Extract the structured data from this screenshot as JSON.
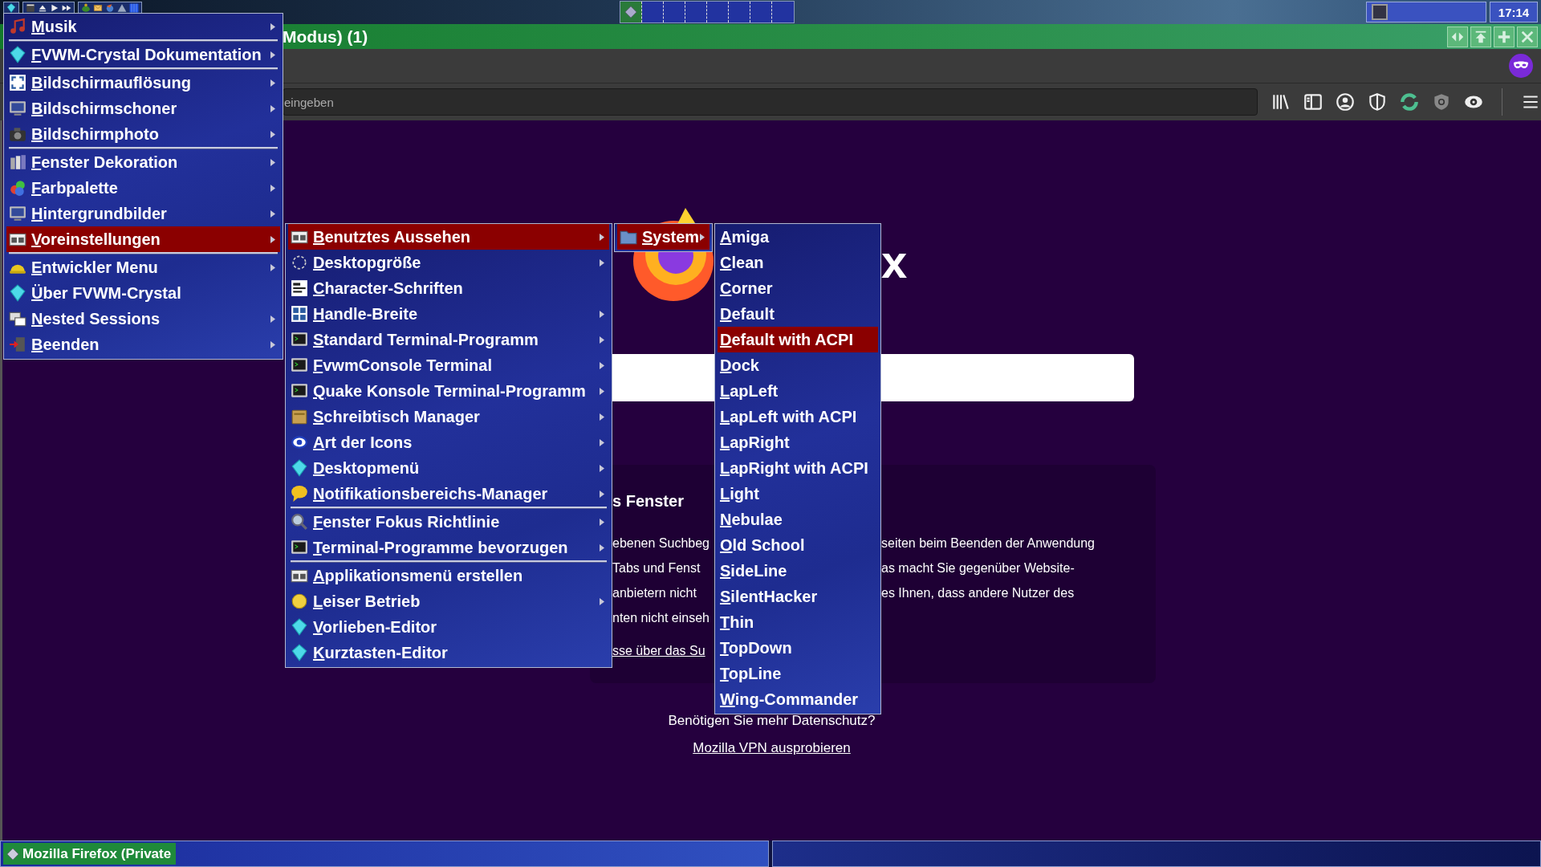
{
  "top_panel": {
    "clock": "17:14"
  },
  "window": {
    "title": "Modus) (1)"
  },
  "url_bar": {
    "placeholder": "eingeben"
  },
  "page": {
    "wordmark": "x",
    "card": {
      "heading": "s Fenster",
      "left_lines": [
        "ebenen Suchbeg",
        "Tabs und Fenst",
        "anbietern nicht",
        "nten nicht einseh"
      ],
      "right_lines": [
        "seiten beim Beenden der Anwendung",
        "as macht Sie gegenüber Website-",
        "es Ihnen, dass andere Nutzer des"
      ],
      "link": "sse über das Su"
    },
    "footer_text": "Benötigen Sie mehr Datenschutz?",
    "footer_link": "Mozilla VPN ausprobieren"
  },
  "taskbar": {
    "tasks": [
      {
        "label": "Mozilla Firefox (Private",
        "selected": true
      }
    ]
  },
  "menus": [
    {
      "items": [
        {
          "label": "Musik",
          "submenu": true,
          "selected": false,
          "divider_after": true
        },
        {
          "label": "FVWM-Crystal Dokumentation",
          "submenu": true,
          "selected": false,
          "divider_after": true
        },
        {
          "label": "Bildschirmauflösung",
          "submenu": true,
          "selected": false,
          "divider_after": false
        },
        {
          "label": "Bildschirmschoner",
          "submenu": true,
          "selected": false,
          "divider_after": false
        },
        {
          "label": "Bildschirmphoto",
          "submenu": true,
          "selected": false,
          "divider_after": true
        },
        {
          "label": "Fenster Dekoration",
          "submenu": true,
          "selected": false,
          "divider_after": false
        },
        {
          "label": "Farbpalette",
          "submenu": true,
          "selected": false,
          "divider_after": false
        },
        {
          "label": "Hintergrundbilder",
          "submenu": true,
          "selected": false,
          "divider_after": false
        },
        {
          "label": "Voreinstellungen",
          "submenu": true,
          "selected": true,
          "divider_after": true
        },
        {
          "label": "Entwickler Menu",
          "submenu": true,
          "selected": false,
          "divider_after": false
        },
        {
          "label": "Über FVWM-Crystal",
          "submenu": false,
          "selected": false,
          "divider_after": false
        },
        {
          "label": "Nested Sessions",
          "submenu": true,
          "selected": false,
          "divider_after": false
        },
        {
          "label": "Beenden",
          "submenu": true,
          "selected": false,
          "divider_after": false
        }
      ]
    },
    {
      "items": [
        {
          "label": "Benutztes Aussehen",
          "submenu": true,
          "selected": true,
          "divider_after": false
        },
        {
          "label": "Desktopgröße",
          "submenu": true,
          "selected": false,
          "divider_after": false
        },
        {
          "label": "Character-Schriften",
          "submenu": false,
          "selected": false,
          "divider_after": false
        },
        {
          "label": "Handle-Breite",
          "submenu": true,
          "selected": false,
          "divider_after": false
        },
        {
          "label": "Standard Terminal-Programm",
          "submenu": true,
          "selected": false,
          "divider_after": false
        },
        {
          "label": "FvwmConsole Terminal",
          "submenu": true,
          "selected": false,
          "divider_after": false
        },
        {
          "label": "Quake Konsole Terminal-Programm",
          "submenu": true,
          "selected": false,
          "divider_after": false
        },
        {
          "label": "Schreibtisch Manager",
          "submenu": true,
          "selected": false,
          "divider_after": false
        },
        {
          "label": "Art der Icons",
          "submenu": true,
          "selected": false,
          "divider_after": false
        },
        {
          "label": "Desktopmenü",
          "submenu": true,
          "selected": false,
          "divider_after": false
        },
        {
          "label": "Notifikationsbereichs-Manager",
          "submenu": true,
          "selected": false,
          "divider_after": true
        },
        {
          "label": "Fenster Fokus Richtlinie",
          "submenu": true,
          "selected": false,
          "divider_after": false
        },
        {
          "label": "Terminal-Programme bevorzugen",
          "submenu": true,
          "selected": false,
          "divider_after": true
        },
        {
          "label": "Applikationsmenü erstellen",
          "submenu": false,
          "selected": false,
          "divider_after": false
        },
        {
          "label": "Leiser Betrieb",
          "submenu": true,
          "selected": false,
          "divider_after": false
        },
        {
          "label": "Vorlieben-Editor",
          "submenu": false,
          "selected": false,
          "divider_after": false
        },
        {
          "label": "Kurztasten-Editor",
          "submenu": false,
          "selected": false,
          "divider_after": false
        }
      ]
    },
    {
      "items": [
        {
          "label": "System",
          "submenu": true,
          "selected": true,
          "divider_after": false
        }
      ]
    },
    {
      "items": [
        {
          "label": "Amiga",
          "submenu": false,
          "selected": false,
          "divider_after": false
        },
        {
          "label": "Clean",
          "submenu": false,
          "selected": false,
          "divider_after": false
        },
        {
          "label": "Corner",
          "submenu": false,
          "selected": false,
          "divider_after": false
        },
        {
          "label": "Default",
          "submenu": false,
          "selected": false,
          "divider_after": false
        },
        {
          "label": "Default with ACPI",
          "submenu": false,
          "selected": true,
          "divider_after": false
        },
        {
          "label": "Dock",
          "submenu": false,
          "selected": false,
          "divider_after": false
        },
        {
          "label": "LapLeft",
          "submenu": false,
          "selected": false,
          "divider_after": false
        },
        {
          "label": "LapLeft with ACPI",
          "submenu": false,
          "selected": false,
          "divider_after": false
        },
        {
          "label": "LapRight",
          "submenu": false,
          "selected": false,
          "divider_after": false
        },
        {
          "label": "LapRight with ACPI",
          "submenu": false,
          "selected": false,
          "divider_after": false
        },
        {
          "label": "Light",
          "submenu": false,
          "selected": false,
          "divider_after": false
        },
        {
          "label": "Nebulae",
          "submenu": false,
          "selected": false,
          "divider_after": false
        },
        {
          "label": "Old School",
          "submenu": false,
          "selected": false,
          "divider_after": false
        },
        {
          "label": "SideLine",
          "submenu": false,
          "selected": false,
          "divider_after": false
        },
        {
          "label": "SilentHacker",
          "submenu": false,
          "selected": false,
          "divider_after": false
        },
        {
          "label": "Thin",
          "submenu": false,
          "selected": false,
          "divider_after": false
        },
        {
          "label": "TopDown",
          "submenu": false,
          "selected": false,
          "divider_after": false
        },
        {
          "label": "TopLine",
          "submenu": false,
          "selected": false,
          "divider_after": false
        },
        {
          "label": "Wing-Commander",
          "submenu": false,
          "selected": false,
          "divider_after": false
        }
      ]
    }
  ]
}
